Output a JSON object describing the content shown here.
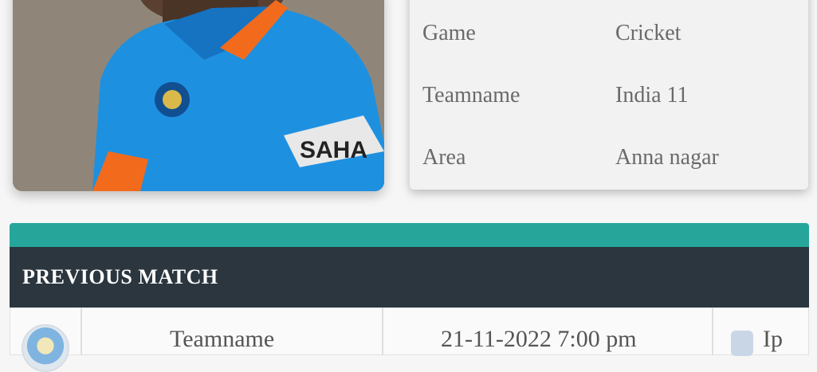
{
  "profile": {
    "info_rows": [
      {
        "label": "Game",
        "value": "Cricket"
      },
      {
        "label": "Teamname",
        "value": "India 11"
      },
      {
        "label": "Area",
        "value": "Anna nagar"
      }
    ]
  },
  "previous_match": {
    "title": "PREVIOUS MATCH",
    "row": {
      "col1_text": "Teamname",
      "col2_text": "21-11-2022  7:00 pm",
      "col3_text": "Ip"
    }
  },
  "colors": {
    "accent": "#26a69a",
    "header_bg": "#2c363f",
    "jersey_blue": "#1e90e0"
  }
}
